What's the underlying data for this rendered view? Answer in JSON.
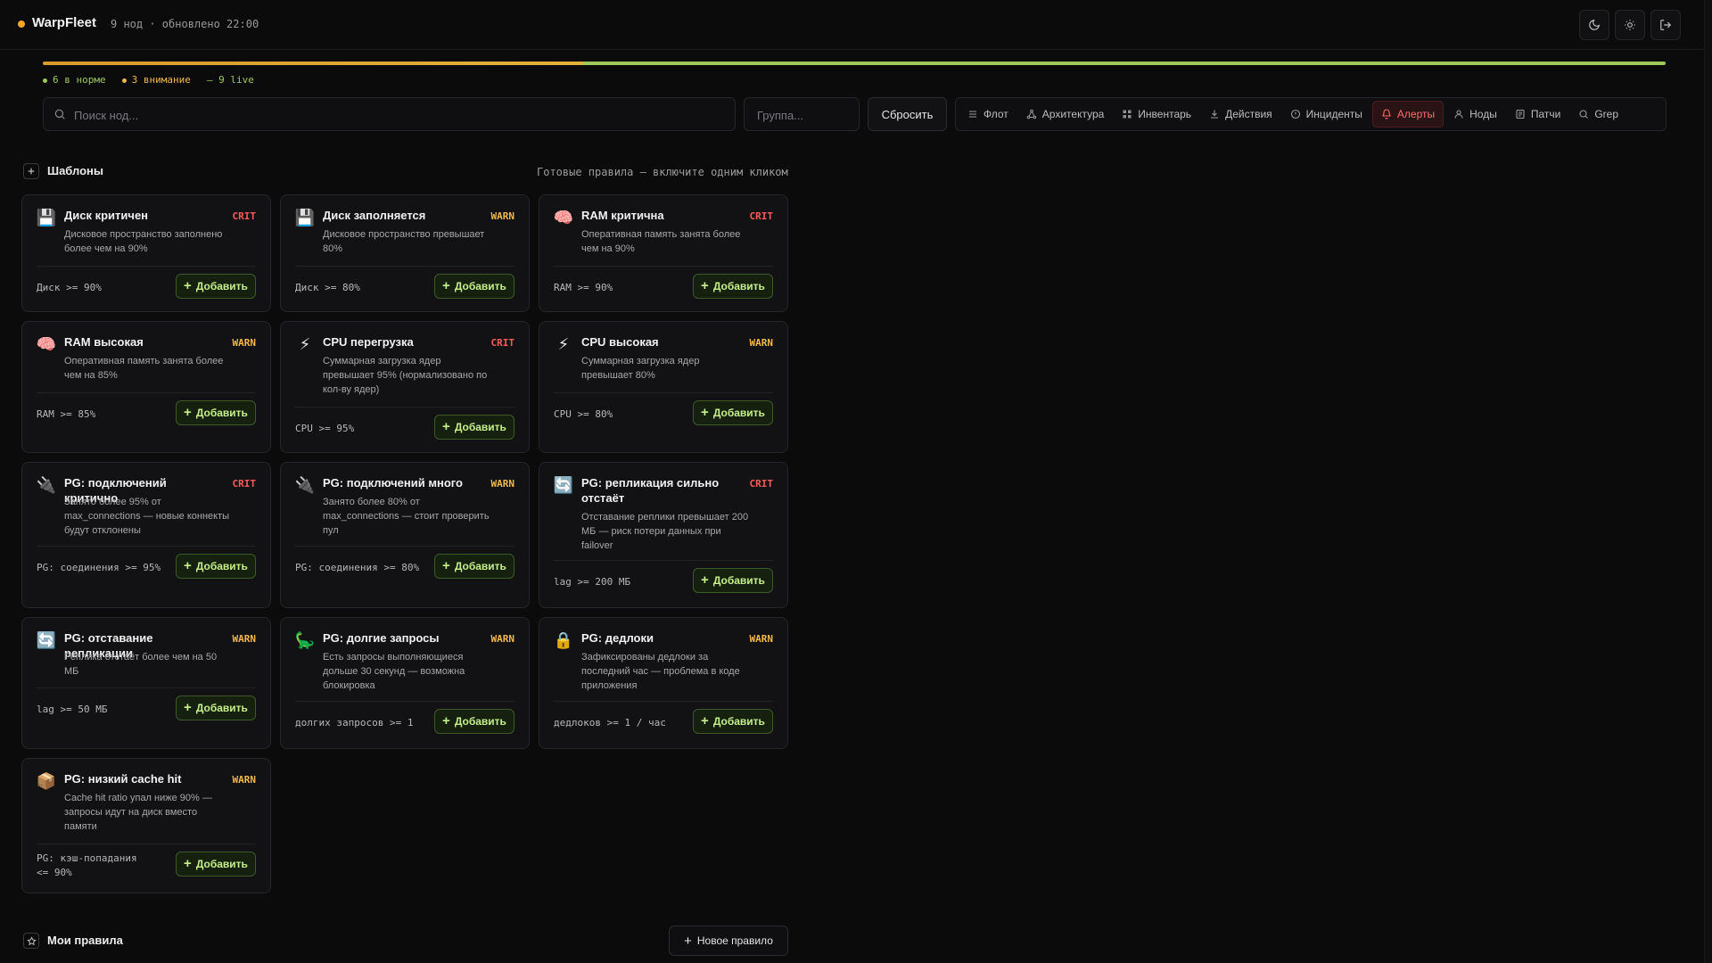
{
  "header": {
    "brand": "WarpFleet",
    "meta": "9 нод · обновлено 22:00"
  },
  "status": {
    "ok_label": "6 в норме",
    "warn_label": "3 внимание",
    "live_label": "— 9 live",
    "ok_fraction": 0.667,
    "warn_fraction": 0.333,
    "colors": {
      "ok": "#9ec85a",
      "warn": "#e1b23a",
      "crit": "#ff5a5a"
    }
  },
  "toolbar": {
    "search_placeholder": "Поиск нод...",
    "group_placeholder": "Группа...",
    "reset_label": "Сбросить",
    "tabs": [
      {
        "label": "Флот",
        "icon": "list-icon"
      },
      {
        "label": "Архитектура",
        "icon": "graph-icon"
      },
      {
        "label": "Инвентарь",
        "icon": "grid-icon"
      },
      {
        "label": "Действия",
        "icon": "download-icon"
      },
      {
        "label": "Инциденты",
        "icon": "alert-circle-icon"
      },
      {
        "label": "Алерты",
        "icon": "bell-icon"
      },
      {
        "label": "Ноды",
        "icon": "user-icon"
      },
      {
        "label": "Патчи",
        "icon": "doc-icon"
      },
      {
        "label": "Grep",
        "icon": "search-icon"
      }
    ]
  },
  "templates": {
    "title": "Шаблоны",
    "subtitle": "Готовые правила — включите одним кликом",
    "add_label": "Добавить",
    "cards": [
      {
        "icon": "💾",
        "icon_name": "floppy-disk-icon",
        "title": "Диск критичен",
        "severity": "CRIT",
        "desc": "Дисковое пространство заполнено более чем на 90%",
        "rule": "Диск >= 90%"
      },
      {
        "icon": "💾",
        "icon_name": "floppy-disk-icon",
        "title": "Диск заполняется",
        "severity": "WARN",
        "desc": "Дисковое пространство превышает 80%",
        "rule": "Диск >= 80%"
      },
      {
        "icon": "🧠",
        "icon_name": "brain-icon",
        "title": "RAM критична",
        "severity": "CRIT",
        "desc": "Оперативная память занята более чем на 90%",
        "rule": "RAM >= 90%"
      },
      {
        "icon": "🧠",
        "icon_name": "brain-icon",
        "title": "RAM высокая",
        "severity": "WARN",
        "desc": "Оперативная память занята более чем на 85%",
        "rule": "RAM >= 85%"
      },
      {
        "icon": "⚡",
        "icon_name": "lightning-icon",
        "title": "CPU перегрузка",
        "severity": "CRIT",
        "desc": "Суммарная загрузка ядер превышает 95% (нормализовано по кол-ву ядер)",
        "rule": "CPU >= 95%"
      },
      {
        "icon": "⚡",
        "icon_name": "lightning-icon",
        "title": "CPU высокая",
        "severity": "WARN",
        "desc": "Суммарная загрузка ядер превышает 80%",
        "rule": "CPU >= 80%"
      },
      {
        "icon": "🔌",
        "icon_name": "plug-icon",
        "title": "PG: подключений критично",
        "severity": "CRIT",
        "desc": "Занято более 95% от max_connections — новые коннекты будут отклонены",
        "rule": "PG: соединения >= 95%"
      },
      {
        "icon": "🔌",
        "icon_name": "plug-icon",
        "title": "PG: подключений много",
        "severity": "WARN",
        "desc": "Занято более 80% от max_connections — стоит проверить пул",
        "rule": "PG: соединения >= 80%"
      },
      {
        "icon": "🔄",
        "icon_name": "sync-icon",
        "title": "PG: репликация сильно отстаёт",
        "severity": "CRIT",
        "desc": "Отставание реплики превышает 200 МБ — риск потери данных при failover",
        "rule": "lag >= 200 МБ"
      },
      {
        "icon": "🔄",
        "icon_name": "sync-icon",
        "title": "PG: отставание репликации",
        "severity": "WARN",
        "desc": "Реплика отстаёт более чем на 50 МБ",
        "rule": "lag >= 50 МБ"
      },
      {
        "icon": "🦕",
        "icon_name": "dinosaur-icon",
        "title": "PG: долгие запросы",
        "severity": "WARN",
        "desc": "Есть запросы выполняющиеся дольше 30 секунд — возможна блокировка",
        "rule": "долгих запросов >= 1"
      },
      {
        "icon": "🔒",
        "icon_name": "lock-icon",
        "title": "PG: дедлоки",
        "severity": "WARN",
        "desc": "Зафиксированы дедлоки за последний час — проблема в коде приложения",
        "rule": "дедлоков >= 1 / час"
      },
      {
        "icon": "📦",
        "icon_name": "package-icon",
        "title": "PG: низкий cache hit",
        "severity": "WARN",
        "desc": "Cache hit ratio упал ниже 90% — запросы идут на диск вместо памяти",
        "rule": "PG: кэш-попадания <= 90%"
      }
    ]
  },
  "my_rules": {
    "title": "Мои правила",
    "new_rule_label": "Новое правило"
  }
}
